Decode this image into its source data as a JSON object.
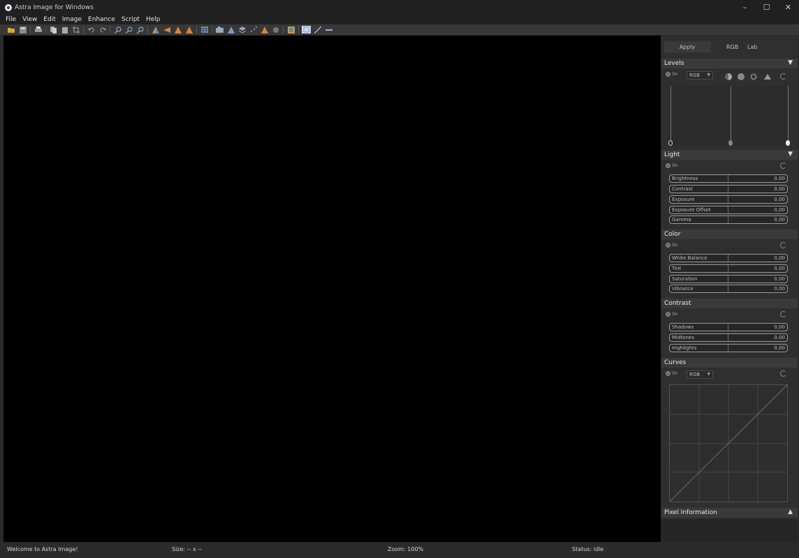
{
  "window": {
    "title": "Astra Image for Windows",
    "minimize": "–",
    "maximize": "☐",
    "close": "✕"
  },
  "menu": [
    "File",
    "View",
    "Edit",
    "Image",
    "Enhance",
    "Script",
    "Help"
  ],
  "toolbar": {
    "icons": [
      "open-icon",
      "save-icon",
      "print-icon",
      "copy-icon",
      "paste-icon",
      "crop-icon",
      "undo-icon",
      "redo-icon",
      "zoom-in-icon",
      "zoom-out-icon",
      "zoom-fit-icon",
      "flip-horizontal-icon",
      "rotate-left-icon",
      "rotate-right-icon",
      "flip-vertical-icon",
      "grid-icon",
      "camera-icon",
      "sharpen-icon",
      "layers-icon",
      "noise-icon",
      "warning-icon",
      "blur-icon",
      "plugin-icon",
      "select-icon",
      "line-icon",
      "minus-icon"
    ]
  },
  "panel": {
    "apply": "Apply",
    "mode_tabs": [
      "RGB",
      "Lab"
    ],
    "levels": {
      "title": "Levels",
      "toggle": "On",
      "channel": "RGB",
      "expand": "▼"
    },
    "light": {
      "title": "Light",
      "toggle": "On",
      "expand": "▼",
      "sliders": [
        {
          "label": "Brightness",
          "value": "0,00"
        },
        {
          "label": "Contrast",
          "value": "0,00"
        },
        {
          "label": "Exposure",
          "value": "0,00"
        },
        {
          "label": "Exposure Offset",
          "value": "0,00"
        },
        {
          "label": "Gamma",
          "value": "0,00"
        }
      ]
    },
    "color": {
      "title": "Color",
      "toggle": "On",
      "sliders": [
        {
          "label": "White Balance",
          "value": "0,00"
        },
        {
          "label": "Tint",
          "value": "0,00"
        },
        {
          "label": "Saturation",
          "value": "0,00"
        },
        {
          "label": "Vibrance",
          "value": "0,00"
        }
      ]
    },
    "contrast": {
      "title": "Contrast",
      "toggle": "On",
      "sliders": [
        {
          "label": "Shadows",
          "value": "0,00"
        },
        {
          "label": "Midtones",
          "value": "0,00"
        },
        {
          "label": "Highlights",
          "value": "0,00"
        }
      ]
    },
    "curves": {
      "title": "Curves",
      "toggle": "On",
      "channel": "RGB"
    },
    "pixel_info": {
      "title": "Pixel Information",
      "expand": "▲"
    }
  },
  "status": {
    "message": "Welcome to Astra Image!",
    "size": "Size: -- x --",
    "zoom": "Zoom: 100%",
    "state": "Status: idle"
  }
}
